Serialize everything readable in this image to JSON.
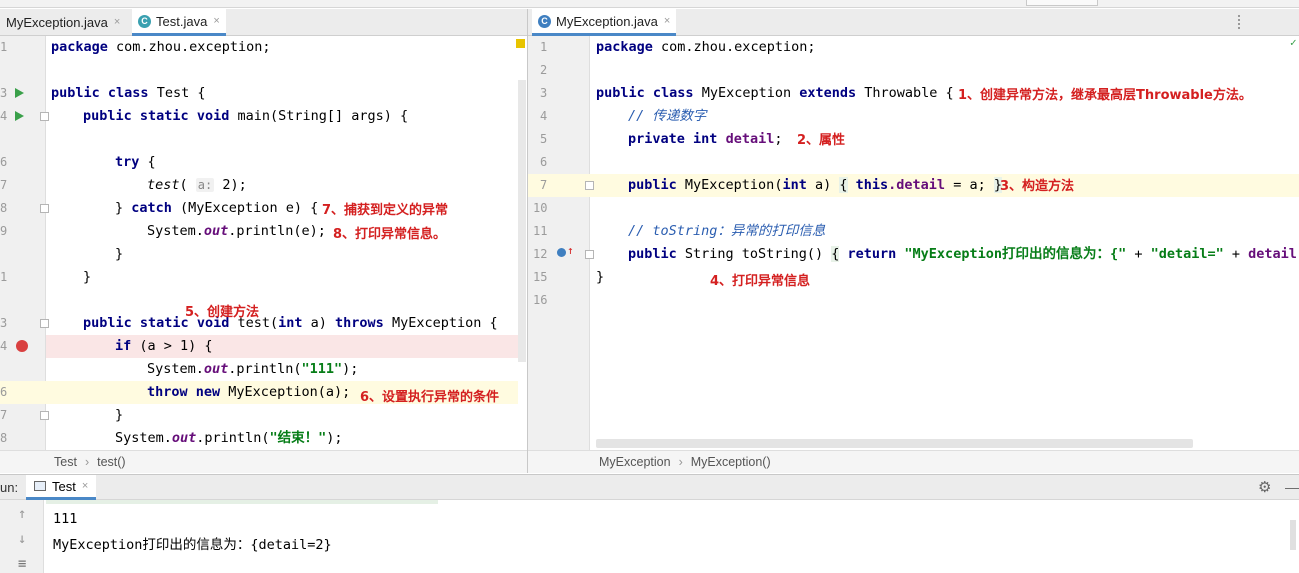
{
  "left_tabs": [
    {
      "label": "MyException.java",
      "active": false
    },
    {
      "label": "Test.java",
      "active": true
    }
  ],
  "right_tabs": [
    {
      "label": "MyException.java",
      "active": true
    }
  ],
  "close_glyph": "×",
  "left_editor": {
    "line_numbers": [
      "1",
      "",
      "3",
      "4",
      "",
      "6",
      "7",
      "8",
      "9",
      "",
      "1",
      "",
      "3",
      "4",
      "",
      "6",
      "7",
      "8"
    ],
    "annotations": {
      "a7": "7、捕获到定义的异常",
      "a8": "8、打印异常信息。",
      "a5": "5、创建方法",
      "a6": "6、设置执行异常的条件"
    },
    "code": {
      "pkg_kw": "package",
      "pkg_name": " com.zhou.exception;",
      "public": "public",
      "class": "class",
      "test_name": " Test {",
      "static": "static",
      "void": "void",
      "main_sig": " main(String[] args) {",
      "try": "try",
      "brace_open": " {",
      "test_call": "test",
      "hint_a": "a:",
      "two": " 2);",
      "close_brace": "} ",
      "catch": "catch",
      "catch_sig": " (MyException e) {",
      "sysout": "System.",
      "out": "out",
      "println_e": ".println(e);",
      "close": "}",
      "test_sig_a": " test(",
      "int": "int",
      "test_sig_b": " a) ",
      "throws": "throws",
      "test_sig_c": " MyException {",
      "if": "if",
      "if_cond": " (a > 1) {",
      "println_open": ".println(",
      "str_111": "\"111\"",
      "close_paren": ");",
      "throw": "throw",
      "new": "new",
      "new_exc": " MyException(a);",
      "str_end": "\"结束！\""
    }
  },
  "right_editor": {
    "line_numbers": [
      "1",
      "2",
      "3",
      "4",
      "5",
      "6",
      "7",
      "10",
      "11",
      "12",
      "15",
      "16"
    ],
    "annotations": {
      "a1": "1、创建异常方法，继承最高层Throwable方法。",
      "a2": "2、属性",
      "a3": "3、构造方法",
      "a4": "4、打印异常信息"
    },
    "code": {
      "pkg_kw": "package",
      "pkg_name": " com.zhou.exception;",
      "public": "public",
      "class": "class",
      "cls_name": " MyException ",
      "extends": "extends",
      "throwable": " Throwable {",
      "cmt1": "// 传递数字",
      "private": "private",
      "int": "int",
      "detail": "detail",
      "semi": ";",
      "ctor": " MyException(",
      "ctor_b": " a) ",
      "lbrace": "{",
      "this": "this",
      "dot_detail": ".detail",
      "assign": " = a; ",
      "rbrace": "}",
      "cmt2": "// toString：异常的打印信息",
      "string_type": " String toString() ",
      "return": "return",
      "str_msg": "\"MyException打印出的信息为：{\"",
      "plus": " + ",
      "str_detail": "\"detail=\"",
      "plus2": " + ",
      "detail2": "detail",
      "close": "}"
    }
  },
  "left_breadcrumb": [
    "Test",
    "test()"
  ],
  "right_breadcrumb": [
    "MyException",
    "MyException()"
  ],
  "breadcrumb_sep": "›",
  "run_panel": {
    "label": "un:",
    "tab": "Test",
    "output": [
      "111",
      "MyException打印出的信息为：{detail=2}"
    ]
  },
  "colors": {
    "keyword": "#000080",
    "string": "#067d17",
    "field": "#660e7a",
    "annotation": "#d42020",
    "active_tab_underline": "#4a88c7"
  }
}
